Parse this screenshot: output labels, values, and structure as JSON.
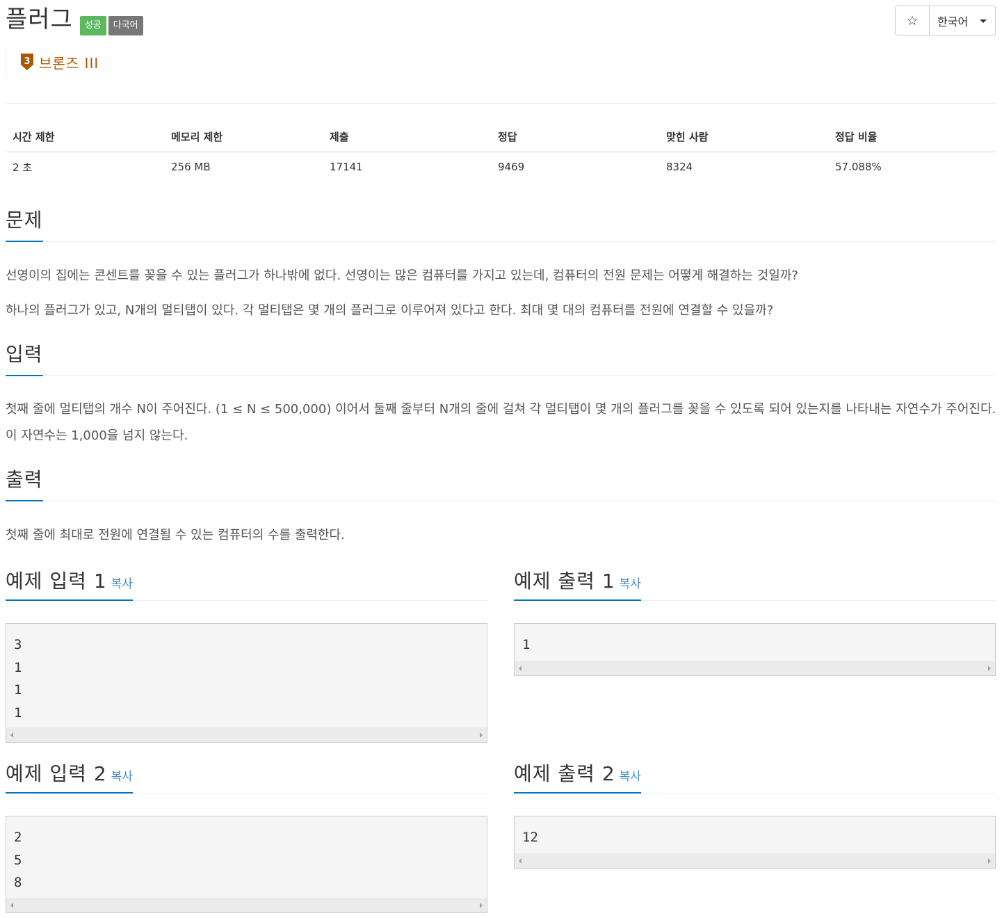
{
  "header": {
    "title": "플러그",
    "labels": [
      "성공",
      "다국어"
    ],
    "star_icon": "star-icon",
    "language": "한국어"
  },
  "tier": {
    "number": "3",
    "name": "브론즈 III",
    "color": "#ad5600"
  },
  "info_table": {
    "headers": [
      "시간 제한",
      "메모리 제한",
      "제출",
      "정답",
      "맞힌 사람",
      "정답 비율"
    ],
    "values": [
      "2 초",
      "256 MB",
      "17141",
      "9469",
      "8324",
      "57.088%"
    ]
  },
  "problem": {
    "heading": "문제",
    "paragraphs": [
      "선영이의 집에는 콘센트를 꽂을 수 있는 플러그가 하나밖에 없다. 선영이는 많은 컴퓨터를 가지고 있는데, 컴퓨터의 전원 문제는 어떻게 해결하는 것일까?",
      "하나의 플러그가 있고, N개의 멀티탭이 있다. 각 멀티탭은 몇 개의 플러그로 이루어져 있다고 한다. 최대 몇 대의 컴퓨터를 전원에 연결할 수 있을까?"
    ]
  },
  "input": {
    "heading": "입력",
    "text": "첫째 줄에 멀티탭의 개수 N이 주어진다. (1 ≤ N ≤ 500,000) 이어서 둘째 줄부터 N개의 줄에 걸쳐 각 멀티탭이 몇 개의 플러그를 꽂을 수 있도록 되어 있는지를 나타내는 자연수가 주어진다. 이 자연수는 1,000을 넘지 않는다."
  },
  "output": {
    "heading": "출력",
    "text": "첫째 줄에 최대로 전원에 연결될 수 있는 컴퓨터의 수를 출력한다."
  },
  "samples": {
    "copy_label": "복사",
    "input1": {
      "title": "예제 입력 1",
      "lines": [
        "3",
        "1",
        "1",
        "1"
      ]
    },
    "output1": {
      "title": "예제 출력 1",
      "lines": [
        "1"
      ]
    },
    "input2": {
      "title": "예제 입력 2",
      "lines": [
        "2",
        "5",
        "8"
      ]
    },
    "output2": {
      "title": "예제 출력 2",
      "lines": [
        "12"
      ]
    }
  },
  "colors": {
    "success": "#5cb85c",
    "default": "#777777",
    "accent": "#0076c0",
    "link": "#428bca"
  }
}
